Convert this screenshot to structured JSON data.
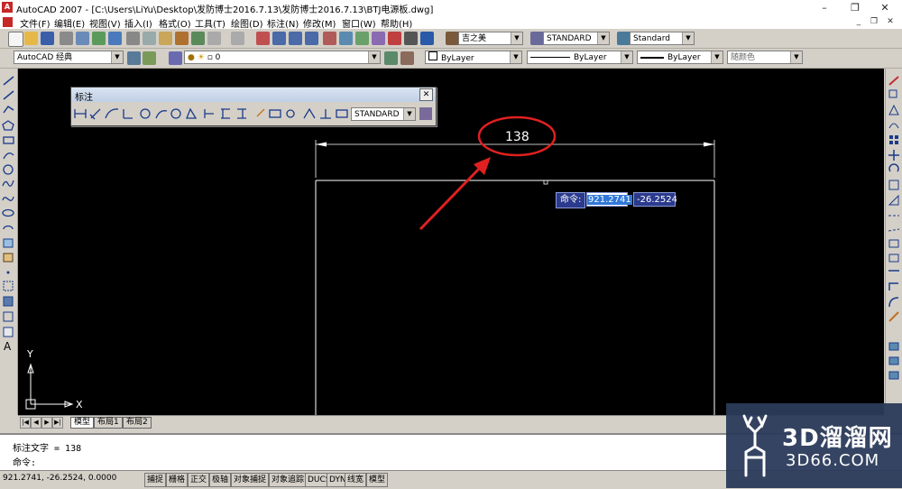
{
  "window": {
    "title": "AutoCAD 2007 - [C:\\Users\\LiYu\\Desktop\\发防博士2016.7.13\\发防博士2016.7.13\\BTJ电源板.dwg]",
    "minimize": "–",
    "restore": "❐",
    "close": "✕"
  },
  "menu": {
    "items": [
      "文件(F)",
      "编辑(E)",
      "视图(V)",
      "插入(I)",
      "格式(O)",
      "工具(T)",
      "绘图(D)",
      "标注(N)",
      "修改(M)",
      "窗口(W)",
      "帮助(H)"
    ],
    "doc_min": "_",
    "doc_restore": "❐",
    "doc_close": "✕"
  },
  "toolbar1": {
    "font_combo": "吉之美",
    "text_style_combo": "STANDARD",
    "dim_style_combo": "Standard"
  },
  "toolbar2": {
    "workspace_combo": "AutoCAD 经典",
    "layer_combo": "0",
    "color_combo": "ByLayer",
    "linetype_combo": "ByLayer",
    "lineweight_combo": "ByLayer",
    "plotstyle_combo": "随颜色"
  },
  "dim_toolbar": {
    "title": "标注",
    "style_combo": "STANDARD"
  },
  "drawing": {
    "dimension_text": "138",
    "dyn_prompt": "命令:",
    "dyn_x": "921.2741",
    "dyn_y": "-26.2524",
    "ucs_x": "X",
    "ucs_y": "Y"
  },
  "tabs": {
    "model": "模型",
    "layout1": "布局1",
    "layout2": "布局2"
  },
  "command": {
    "line1": "标注文字 = 138",
    "line2": "命令:"
  },
  "status": {
    "coords": "921.2741,  -26.2524, 0.0000",
    "buttons": [
      "捕捉",
      "栅格",
      "正交",
      "极轴",
      "对象捕捉",
      "对象追踪",
      "DUCS",
      "DYN",
      "线宽",
      "模型"
    ]
  },
  "watermark": {
    "big": "3D溜溜网",
    "small": "3D66.COM"
  },
  "colors": {
    "canvas": "#000000",
    "annotation_red": "#e02020",
    "dyn_box": "#2b3a8c"
  }
}
